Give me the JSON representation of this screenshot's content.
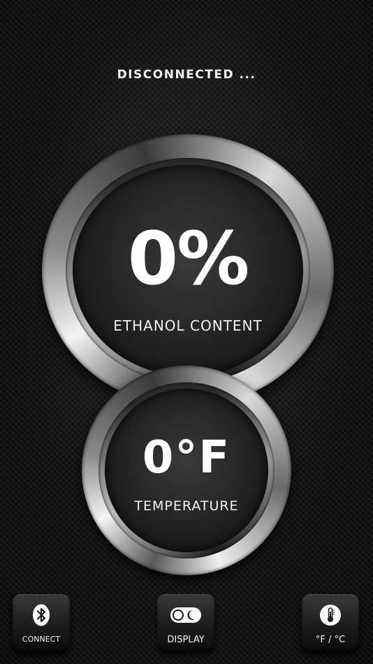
{
  "status": {
    "text": "DISCONNECTED ..."
  },
  "ethanol": {
    "value": "0%",
    "label": "ETHANOL CONTENT"
  },
  "temperature": {
    "value": "0°F",
    "label": "TEMPERATURE"
  },
  "toolbar": {
    "connect": {
      "label": "CONNECT",
      "icon": "bluetooth-icon"
    },
    "display": {
      "label": "DISPLAY",
      "icon": "day-night-toggle-icon"
    },
    "unit": {
      "label": "°F / °C",
      "icon": "thermometer-icon"
    }
  }
}
